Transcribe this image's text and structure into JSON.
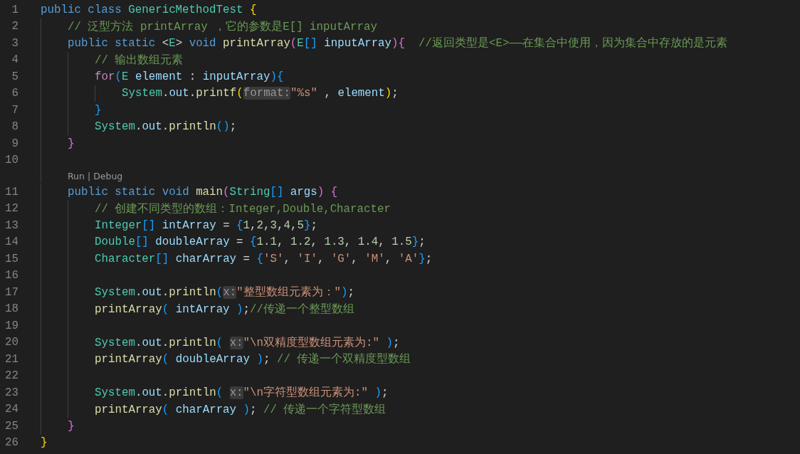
{
  "editor": {
    "lines": [
      {
        "number": "1",
        "tokens": [
          {
            "kind": "kw",
            "text": "public class "
          },
          {
            "kind": "type",
            "text": "GenericMethodTest"
          },
          {
            "kind": "b1",
            "text": " {"
          }
        ],
        "children": [
          {
            "number": "2",
            "tokens": [
              {
                "kind": "cmt",
                "text": "// 泛型方法 printArray ，它的参数是E[] inputArray"
              }
            ]
          },
          {
            "number": "3",
            "tokens": [
              {
                "kind": "kw",
                "text": "public static "
              },
              {
                "kind": "p",
                "text": "<"
              },
              {
                "kind": "type",
                "text": "E"
              },
              {
                "kind": "p",
                "text": "> "
              },
              {
                "kind": "kw",
                "text": "void "
              },
              {
                "kind": "fn",
                "text": "printArray"
              },
              {
                "kind": "b2",
                "text": "("
              },
              {
                "kind": "type",
                "text": "E"
              },
              {
                "kind": "b3",
                "text": "[]"
              },
              {
                "kind": "var",
                "text": " inputArray"
              },
              {
                "kind": "b2",
                "text": ")"
              },
              {
                "kind": "b2",
                "text": "{"
              },
              {
                "kind": "cmt",
                "text": "  //返回类型是<E>——在集合中使用，因为集合中存放的是元素"
              }
            ],
            "children": [
              {
                "number": "4",
                "tokens": [
                  {
                    "kind": "cmt",
                    "text": "// 输出数组元素"
                  }
                ]
              },
              {
                "number": "5",
                "tokens": [
                  {
                    "kind": "ctl",
                    "text": "for"
                  },
                  {
                    "kind": "b3",
                    "text": "("
                  },
                  {
                    "kind": "type",
                    "text": "E"
                  },
                  {
                    "kind": "var",
                    "text": " element"
                  },
                  {
                    "kind": "p",
                    "text": " : "
                  },
                  {
                    "kind": "var",
                    "text": "inputArray"
                  },
                  {
                    "kind": "b3",
                    "text": ")"
                  },
                  {
                    "kind": "b3",
                    "text": "{"
                  }
                ],
                "children": [
                  {
                    "number": "6",
                    "tokens": [
                      {
                        "kind": "type",
                        "text": "System"
                      },
                      {
                        "kind": "p",
                        "text": "."
                      },
                      {
                        "kind": "var",
                        "text": "out"
                      },
                      {
                        "kind": "p",
                        "text": "."
                      },
                      {
                        "kind": "fn",
                        "text": "printf"
                      },
                      {
                        "kind": "b1",
                        "text": "("
                      },
                      {
                        "kind": "hint",
                        "text": "format:"
                      },
                      {
                        "kind": "str",
                        "text": "\"%s\""
                      },
                      {
                        "kind": "p",
                        "text": " , "
                      },
                      {
                        "kind": "var",
                        "text": "element"
                      },
                      {
                        "kind": "b1",
                        "text": ")"
                      },
                      {
                        "kind": "p",
                        "text": ";"
                      }
                    ]
                  }
                ]
              },
              {
                "number": "7",
                "tokens": [
                  {
                    "kind": "b3",
                    "text": "}"
                  }
                ]
              },
              {
                "number": "8",
                "tokens": [
                  {
                    "kind": "type",
                    "text": "System"
                  },
                  {
                    "kind": "p",
                    "text": "."
                  },
                  {
                    "kind": "var",
                    "text": "out"
                  },
                  {
                    "kind": "p",
                    "text": "."
                  },
                  {
                    "kind": "fn",
                    "text": "println"
                  },
                  {
                    "kind": "b3",
                    "text": "()"
                  },
                  {
                    "kind": "p",
                    "text": ";"
                  }
                ]
              }
            ]
          },
          {
            "number": "9",
            "tokens": [
              {
                "kind": "b2",
                "text": "}"
              }
            ]
          },
          {
            "number": "10"
          },
          {
            "kind": "codelens",
            "actions": [
              "Run",
              "Debug"
            ],
            "separator": "|"
          },
          {
            "number": "11",
            "tokens": [
              {
                "kind": "kw",
                "text": "public static void "
              },
              {
                "kind": "fn",
                "text": "main"
              },
              {
                "kind": "b2",
                "text": "("
              },
              {
                "kind": "type",
                "text": "String"
              },
              {
                "kind": "b3",
                "text": "[]"
              },
              {
                "kind": "var",
                "text": " args"
              },
              {
                "kind": "b2",
                "text": ")"
              },
              {
                "kind": "b2",
                "text": " {"
              }
            ],
            "children": [
              {
                "number": "12",
                "tokens": [
                  {
                    "kind": "cmt",
                    "text": "// 创建不同类型的数组：Integer,Double,Character"
                  }
                ]
              },
              {
                "number": "13",
                "tokens": [
                  {
                    "kind": "type",
                    "text": "Integer"
                  },
                  {
                    "kind": "b3",
                    "text": "[]"
                  },
                  {
                    "kind": "var",
                    "text": " intArray"
                  },
                  {
                    "kind": "p",
                    "text": " = "
                  },
                  {
                    "kind": "b3",
                    "text": "{"
                  },
                  {
                    "kind": "num",
                    "text": "1"
                  },
                  {
                    "kind": "p",
                    "text": ","
                  },
                  {
                    "kind": "num",
                    "text": "2"
                  },
                  {
                    "kind": "p",
                    "text": ","
                  },
                  {
                    "kind": "num",
                    "text": "3"
                  },
                  {
                    "kind": "p",
                    "text": ","
                  },
                  {
                    "kind": "num",
                    "text": "4"
                  },
                  {
                    "kind": "p",
                    "text": ","
                  },
                  {
                    "kind": "num",
                    "text": "5"
                  },
                  {
                    "kind": "b3",
                    "text": "}"
                  },
                  {
                    "kind": "p",
                    "text": ";"
                  }
                ]
              },
              {
                "number": "14",
                "tokens": [
                  {
                    "kind": "type",
                    "text": "Double"
                  },
                  {
                    "kind": "b3",
                    "text": "[]"
                  },
                  {
                    "kind": "var",
                    "text": " doubleArray"
                  },
                  {
                    "kind": "p",
                    "text": " = "
                  },
                  {
                    "kind": "b3",
                    "text": "{"
                  },
                  {
                    "kind": "num",
                    "text": "1.1"
                  },
                  {
                    "kind": "p",
                    "text": ", "
                  },
                  {
                    "kind": "num",
                    "text": "1.2"
                  },
                  {
                    "kind": "p",
                    "text": ", "
                  },
                  {
                    "kind": "num",
                    "text": "1.3"
                  },
                  {
                    "kind": "p",
                    "text": ", "
                  },
                  {
                    "kind": "num",
                    "text": "1.4"
                  },
                  {
                    "kind": "p",
                    "text": ", "
                  },
                  {
                    "kind": "num",
                    "text": "1.5"
                  },
                  {
                    "kind": "b3",
                    "text": "}"
                  },
                  {
                    "kind": "p",
                    "text": ";"
                  }
                ]
              },
              {
                "number": "15",
                "tokens": [
                  {
                    "kind": "type",
                    "text": "Character"
                  },
                  {
                    "kind": "b3",
                    "text": "[]"
                  },
                  {
                    "kind": "var",
                    "text": " charArray"
                  },
                  {
                    "kind": "p",
                    "text": " = "
                  },
                  {
                    "kind": "b3",
                    "text": "{"
                  },
                  {
                    "kind": "str",
                    "text": "'S'"
                  },
                  {
                    "kind": "p",
                    "text": ", "
                  },
                  {
                    "kind": "str",
                    "text": "'I'"
                  },
                  {
                    "kind": "p",
                    "text": ", "
                  },
                  {
                    "kind": "str",
                    "text": "'G'"
                  },
                  {
                    "kind": "p",
                    "text": ", "
                  },
                  {
                    "kind": "str",
                    "text": "'M'"
                  },
                  {
                    "kind": "p",
                    "text": ", "
                  },
                  {
                    "kind": "str",
                    "text": "'A'"
                  },
                  {
                    "kind": "b3",
                    "text": "}"
                  },
                  {
                    "kind": "p",
                    "text": ";"
                  }
                ]
              },
              {
                "number": "16"
              },
              {
                "number": "17",
                "tokens": [
                  {
                    "kind": "type",
                    "text": "System"
                  },
                  {
                    "kind": "p",
                    "text": "."
                  },
                  {
                    "kind": "var",
                    "text": "out"
                  },
                  {
                    "kind": "p",
                    "text": "."
                  },
                  {
                    "kind": "fn",
                    "text": "println"
                  },
                  {
                    "kind": "b3",
                    "text": "("
                  },
                  {
                    "kind": "hint",
                    "text": "x:"
                  },
                  {
                    "kind": "str",
                    "text": "\"整型数组元素为：\""
                  },
                  {
                    "kind": "b3",
                    "text": ")"
                  },
                  {
                    "kind": "p",
                    "text": ";"
                  }
                ]
              },
              {
                "number": "18",
                "tokens": [
                  {
                    "kind": "fn",
                    "text": "printArray"
                  },
                  {
                    "kind": "b3",
                    "text": "( "
                  },
                  {
                    "kind": "var",
                    "text": "intArray"
                  },
                  {
                    "kind": "b3",
                    "text": " )"
                  },
                  {
                    "kind": "p",
                    "text": ";"
                  },
                  {
                    "kind": "cmt",
                    "text": "//传递一个整型数组"
                  }
                ]
              },
              {
                "number": "19"
              },
              {
                "number": "20",
                "tokens": [
                  {
                    "kind": "type",
                    "text": "System"
                  },
                  {
                    "kind": "p",
                    "text": "."
                  },
                  {
                    "kind": "var",
                    "text": "out"
                  },
                  {
                    "kind": "p",
                    "text": "."
                  },
                  {
                    "kind": "fn",
                    "text": "println"
                  },
                  {
                    "kind": "b3",
                    "text": "( "
                  },
                  {
                    "kind": "hint",
                    "text": "x:"
                  },
                  {
                    "kind": "str",
                    "text": "\"\\n双精度型数组元素为:\""
                  },
                  {
                    "kind": "b3",
                    "text": " )"
                  },
                  {
                    "kind": "p",
                    "text": ";"
                  }
                ]
              },
              {
                "number": "21",
                "tokens": [
                  {
                    "kind": "fn",
                    "text": "printArray"
                  },
                  {
                    "kind": "b3",
                    "text": "( "
                  },
                  {
                    "kind": "var",
                    "text": "doubleArray"
                  },
                  {
                    "kind": "b3",
                    "text": " )"
                  },
                  {
                    "kind": "p",
                    "text": "; "
                  },
                  {
                    "kind": "cmt",
                    "text": "// 传递一个双精度型数组"
                  }
                ]
              },
              {
                "number": "22"
              },
              {
                "number": "23",
                "tokens": [
                  {
                    "kind": "type",
                    "text": "System"
                  },
                  {
                    "kind": "p",
                    "text": "."
                  },
                  {
                    "kind": "var",
                    "text": "out"
                  },
                  {
                    "kind": "p",
                    "text": "."
                  },
                  {
                    "kind": "fn",
                    "text": "println"
                  },
                  {
                    "kind": "b3",
                    "text": "( "
                  },
                  {
                    "kind": "hint",
                    "text": "x:"
                  },
                  {
                    "kind": "str",
                    "text": "\"\\n字符型数组元素为:\""
                  },
                  {
                    "kind": "b3",
                    "text": " )"
                  },
                  {
                    "kind": "p",
                    "text": ";"
                  }
                ]
              },
              {
                "number": "24",
                "tokens": [
                  {
                    "kind": "fn",
                    "text": "printArray"
                  },
                  {
                    "kind": "b3",
                    "text": "( "
                  },
                  {
                    "kind": "var",
                    "text": "charArray"
                  },
                  {
                    "kind": "b3",
                    "text": " )"
                  },
                  {
                    "kind": "p",
                    "text": "; "
                  },
                  {
                    "kind": "cmt",
                    "text": "// 传递一个字符型数组"
                  }
                ]
              }
            ]
          },
          {
            "number": "25",
            "tokens": [
              {
                "kind": "b2",
                "text": "}"
              }
            ]
          }
        ]
      },
      {
        "number": "26",
        "tokens": [
          {
            "kind": "b1",
            "text": "}"
          }
        ]
      }
    ]
  }
}
